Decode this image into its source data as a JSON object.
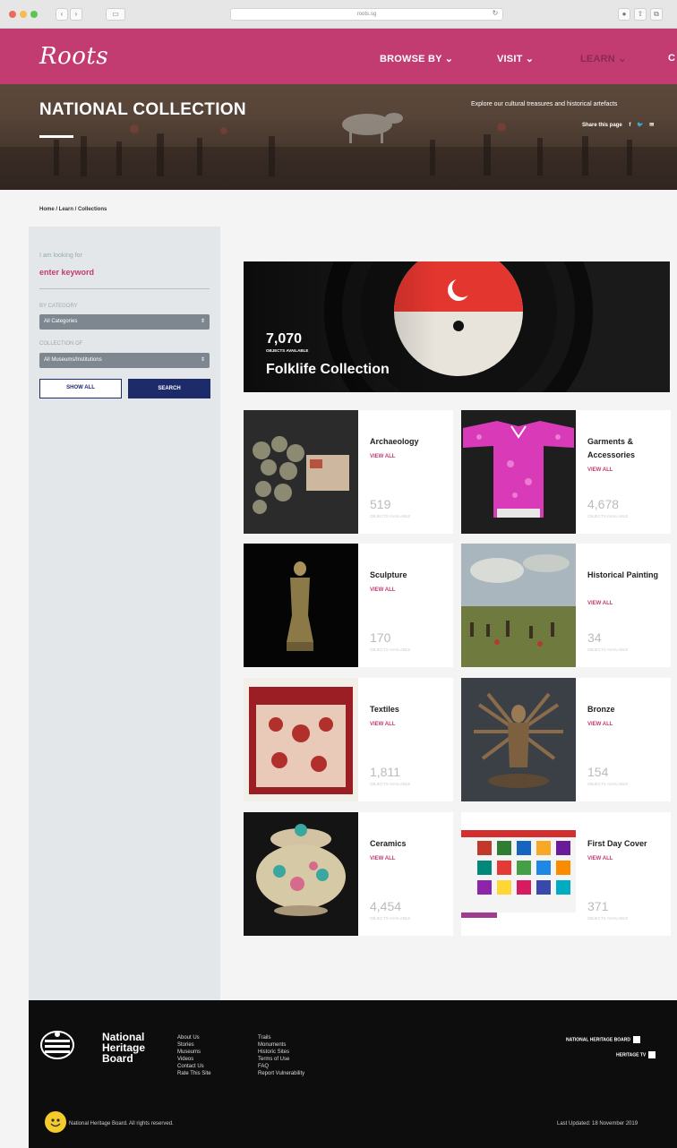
{
  "browser": {
    "url": "roots.sg"
  },
  "header": {
    "logo": "Roots",
    "nav": [
      "BROWSE BY",
      "VISIT",
      "LEARN",
      "C"
    ]
  },
  "hero": {
    "title": "NATIONAL COLLECTION",
    "tagline": "Explore our cultural treasures and historical artefacts",
    "share_label": "Share this page"
  },
  "breadcrumb": "Home  /  Learn  /  Collections",
  "sidebar": {
    "looking_for": "I am looking for",
    "keyword_placeholder": "enter keyword",
    "by_category_label": "BY CATEGORY",
    "category_value": "All Categories",
    "collection_of_label": "COLLECTION OF",
    "collection_value": "All Museums/Institutions",
    "show_all": "SHOW ALL",
    "search": "SEARCH"
  },
  "featured": {
    "count": "7,070",
    "available": "OBJECTS AVAILABLE",
    "name": "Folklife Collection"
  },
  "collections": [
    {
      "name": "Archaeology",
      "view_all": "VIEW ALL",
      "count": "519",
      "available": "OBJECTS AVAILABLE"
    },
    {
      "name": "Garments & Accessories",
      "view_all": "VIEW ALL",
      "count": "4,678",
      "available": "OBJECTS AVAILABLE"
    },
    {
      "name": "Sculpture",
      "view_all": "VIEW ALL",
      "count": "170",
      "available": "OBJECTS AVAILABLE"
    },
    {
      "name": "Historical Painting",
      "view_all": "VIEW ALL",
      "count": "34",
      "available": "OBJECTS AVAILABLE"
    },
    {
      "name": "Textiles",
      "view_all": "VIEW ALL",
      "count": "1,811",
      "available": "OBJECTS AVAILABLE"
    },
    {
      "name": "Bronze",
      "view_all": "VIEW ALL",
      "count": "154",
      "available": "OBJECTS AVAILABLE"
    },
    {
      "name": "Ceramics",
      "view_all": "VIEW ALL",
      "count": "4,454",
      "available": "OBJECTS AVAILABLE"
    },
    {
      "name": "First Day Cover",
      "view_all": "VIEW ALL",
      "count": "371",
      "available": "OBJECTS AVAILABLE"
    }
  ],
  "footer": {
    "org_line1": "National",
    "org_line2": "Heritage",
    "org_line3": "Board",
    "links_col1": [
      "About Us",
      "Stories",
      "Museums",
      "Videos",
      "Contact Us",
      "Rate This Site"
    ],
    "links_col2": [
      "Trails",
      "Monuments",
      "Historic Sites",
      "Terms of Use",
      "FAQ",
      "Report Vulnerability"
    ],
    "nhb_link": "NATIONAL HERITAGE BOARD",
    "heritage_tv": "HERITAGE TV",
    "copyright": "National Heritage Board. All rights reserved.",
    "last_updated": "Last Updated: 18 November 2019"
  },
  "colors": {
    "brand": "#c23b71",
    "navy": "#1d2b6b",
    "sidebar": "#e4e7ea",
    "footer": "#0d0d0d"
  }
}
